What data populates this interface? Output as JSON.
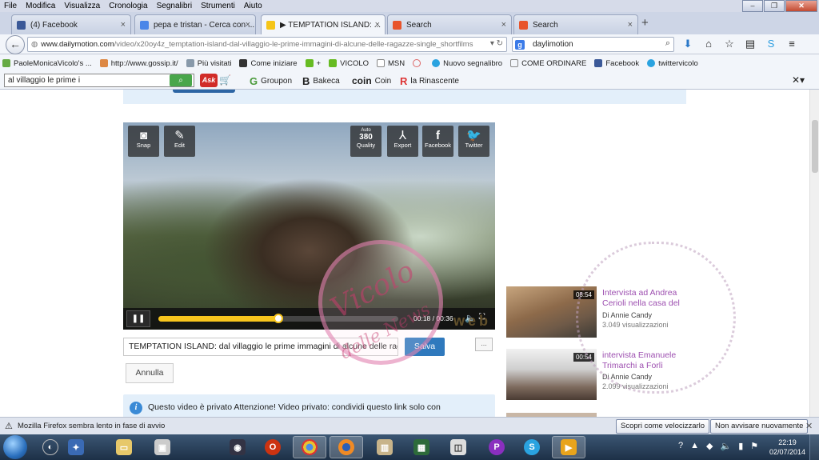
{
  "menu": [
    "File",
    "Modifica",
    "Visualizza",
    "Cronologia",
    "Segnalibri",
    "Strumenti",
    "Aiuto"
  ],
  "tabs": [
    {
      "label": "(4) Facebook",
      "icon": "facebook-icon",
      "color": "#3b5998"
    },
    {
      "label": "pepa e tristan - Cerca con ...",
      "icon": "google-icon",
      "color": "#4a86e8"
    },
    {
      "label": "▶ TEMPTATION ISLAND: ...",
      "icon": "dailymotion-icon",
      "color": "#f5c518",
      "active": true
    },
    {
      "label": "Search",
      "icon": "bing-icon",
      "color": "#e8542b"
    },
    {
      "label": "Search",
      "icon": "bing-icon",
      "color": "#e8542b"
    }
  ],
  "nav": {
    "url_host": "www.dailymotion.com",
    "url_path": "/video/x20oy4z_temptation-island-dal-villaggio-le-prime-immagini-di-alcune-delle-ragazze-single_shortfilms",
    "search_value": "daylimotion"
  },
  "bookmarks": [
    "PaoleMonicaVicolo's ...",
    "http://www.gossip.it/",
    "Più visitati",
    "Come iniziare",
    "+",
    "VICOLO",
    "MSN",
    "Nuovo segnalibro",
    "COME ORDINARE",
    "Facebook",
    "twittervicolo"
  ],
  "ask": {
    "query": "al villaggio le prime i",
    "logo": "Ask",
    "links": [
      "Groupon",
      "Bakeca",
      "Coin",
      "la Rinascente"
    ]
  },
  "video": {
    "buttons": [
      {
        "label": "Snap",
        "icon": "camera-icon"
      },
      {
        "label": "Edit",
        "icon": "edit-icon"
      },
      {
        "label": "Quality",
        "icon": "quality-icon",
        "top": "Auto",
        "value": "380"
      },
      {
        "label": "Export",
        "icon": "export-icon"
      },
      {
        "label": "Facebook",
        "icon": "facebook-icon"
      },
      {
        "label": "Twitter",
        "icon": "twitter-icon"
      }
    ],
    "time": "00:18 / 00:36",
    "progress": 0.5
  },
  "form": {
    "title_value": "TEMPTATION ISLAND: dal villaggio le prime immagini di alcune delle ragazze single",
    "save_label": "Salva",
    "cancel_label": "Annulla",
    "dots_label": "...",
    "info": "Questo video è privato Attenzione! Video privato: condividi questo link solo con"
  },
  "related": [
    {
      "duration": "08:54",
      "title": "Intervista ad Andrea Cerioli nella casa del",
      "by_prefix": "Di",
      "author": "Annie Candy",
      "views": "3.049 visualizzazioni"
    },
    {
      "duration": "00:54",
      "title": "intervista Emanuele Trimarchi a Forlì",
      "by_prefix": "Di",
      "author": "Annie Candy",
      "views": "2.099 visualizzazioni"
    }
  ],
  "watermark": {
    "line1": "Vicolo",
    "line2": "delle",
    "line3": "News",
    "web": "web"
  },
  "status": {
    "message": "Mozilla Firefox sembra lento in fase di avvio",
    "btn_speed": "Scopri come velocizzarlo",
    "btn_dismiss": "Non avvisare nuovamente"
  },
  "taskbar": {
    "time": "22:19",
    "date": "02/07/2014"
  }
}
